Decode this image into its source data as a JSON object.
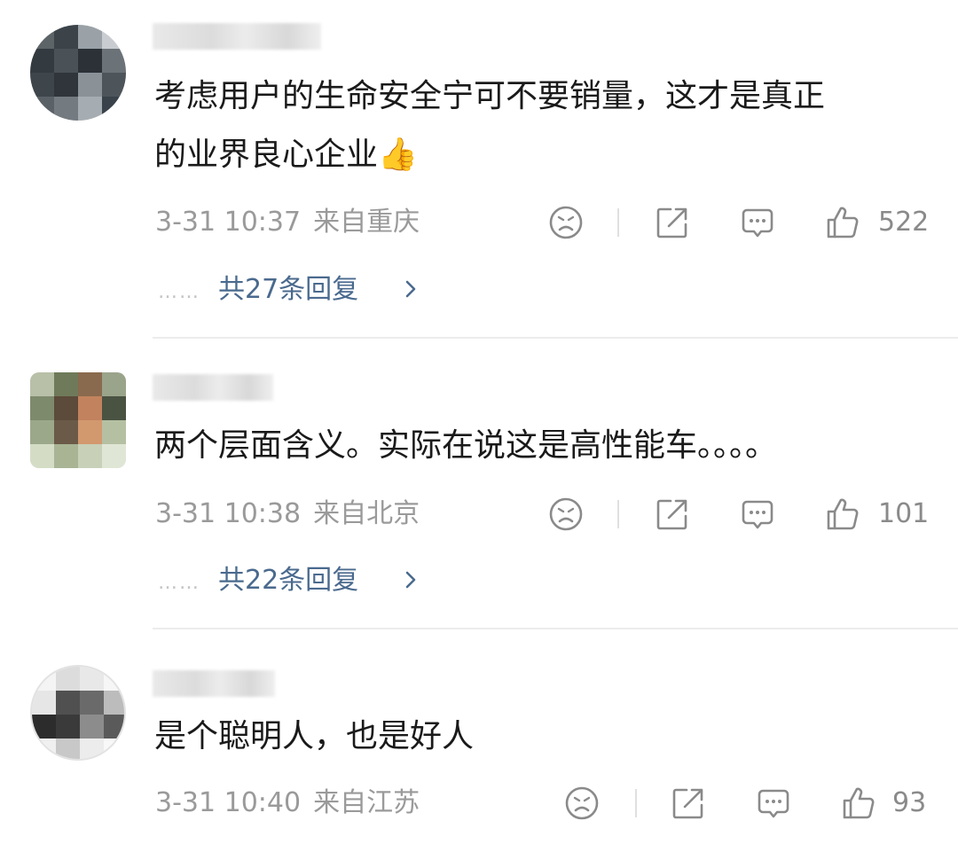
{
  "comments": [
    {
      "text_line1": "考虑用户的生命安全宁可不要销量，这才是真正",
      "text_line2": "的业界良心企业👍",
      "time": "3-31 10:37",
      "location": "来自重庆",
      "likes": "522",
      "replies_label": "共27条回复",
      "dots": "……",
      "icons": [
        "sad-face-icon",
        "share-icon",
        "comment-icon",
        "thumbs-up-icon"
      ]
    },
    {
      "text_line1": "两个层面含义。实际在说这是高性能车。。。。",
      "time": "3-31 10:38",
      "location": "来自北京",
      "likes": "101",
      "replies_label": "共22条回复",
      "dots": "……",
      "icons": [
        "sad-face-icon",
        "share-icon",
        "comment-icon",
        "thumbs-up-icon"
      ]
    },
    {
      "text_line1": "是个聪明人，也是好人",
      "time": "3-31 10:40",
      "location": "来自江苏",
      "likes": "93",
      "icons": [
        "sad-face-icon",
        "share-icon",
        "comment-icon",
        "thumbs-up-icon"
      ]
    }
  ],
  "colors": {
    "text": "#1a1a1a",
    "meta": "#9a9a9a",
    "reply_link": "#4a6a8e",
    "icon": "#8a8a8a",
    "separator": "#ececec"
  }
}
